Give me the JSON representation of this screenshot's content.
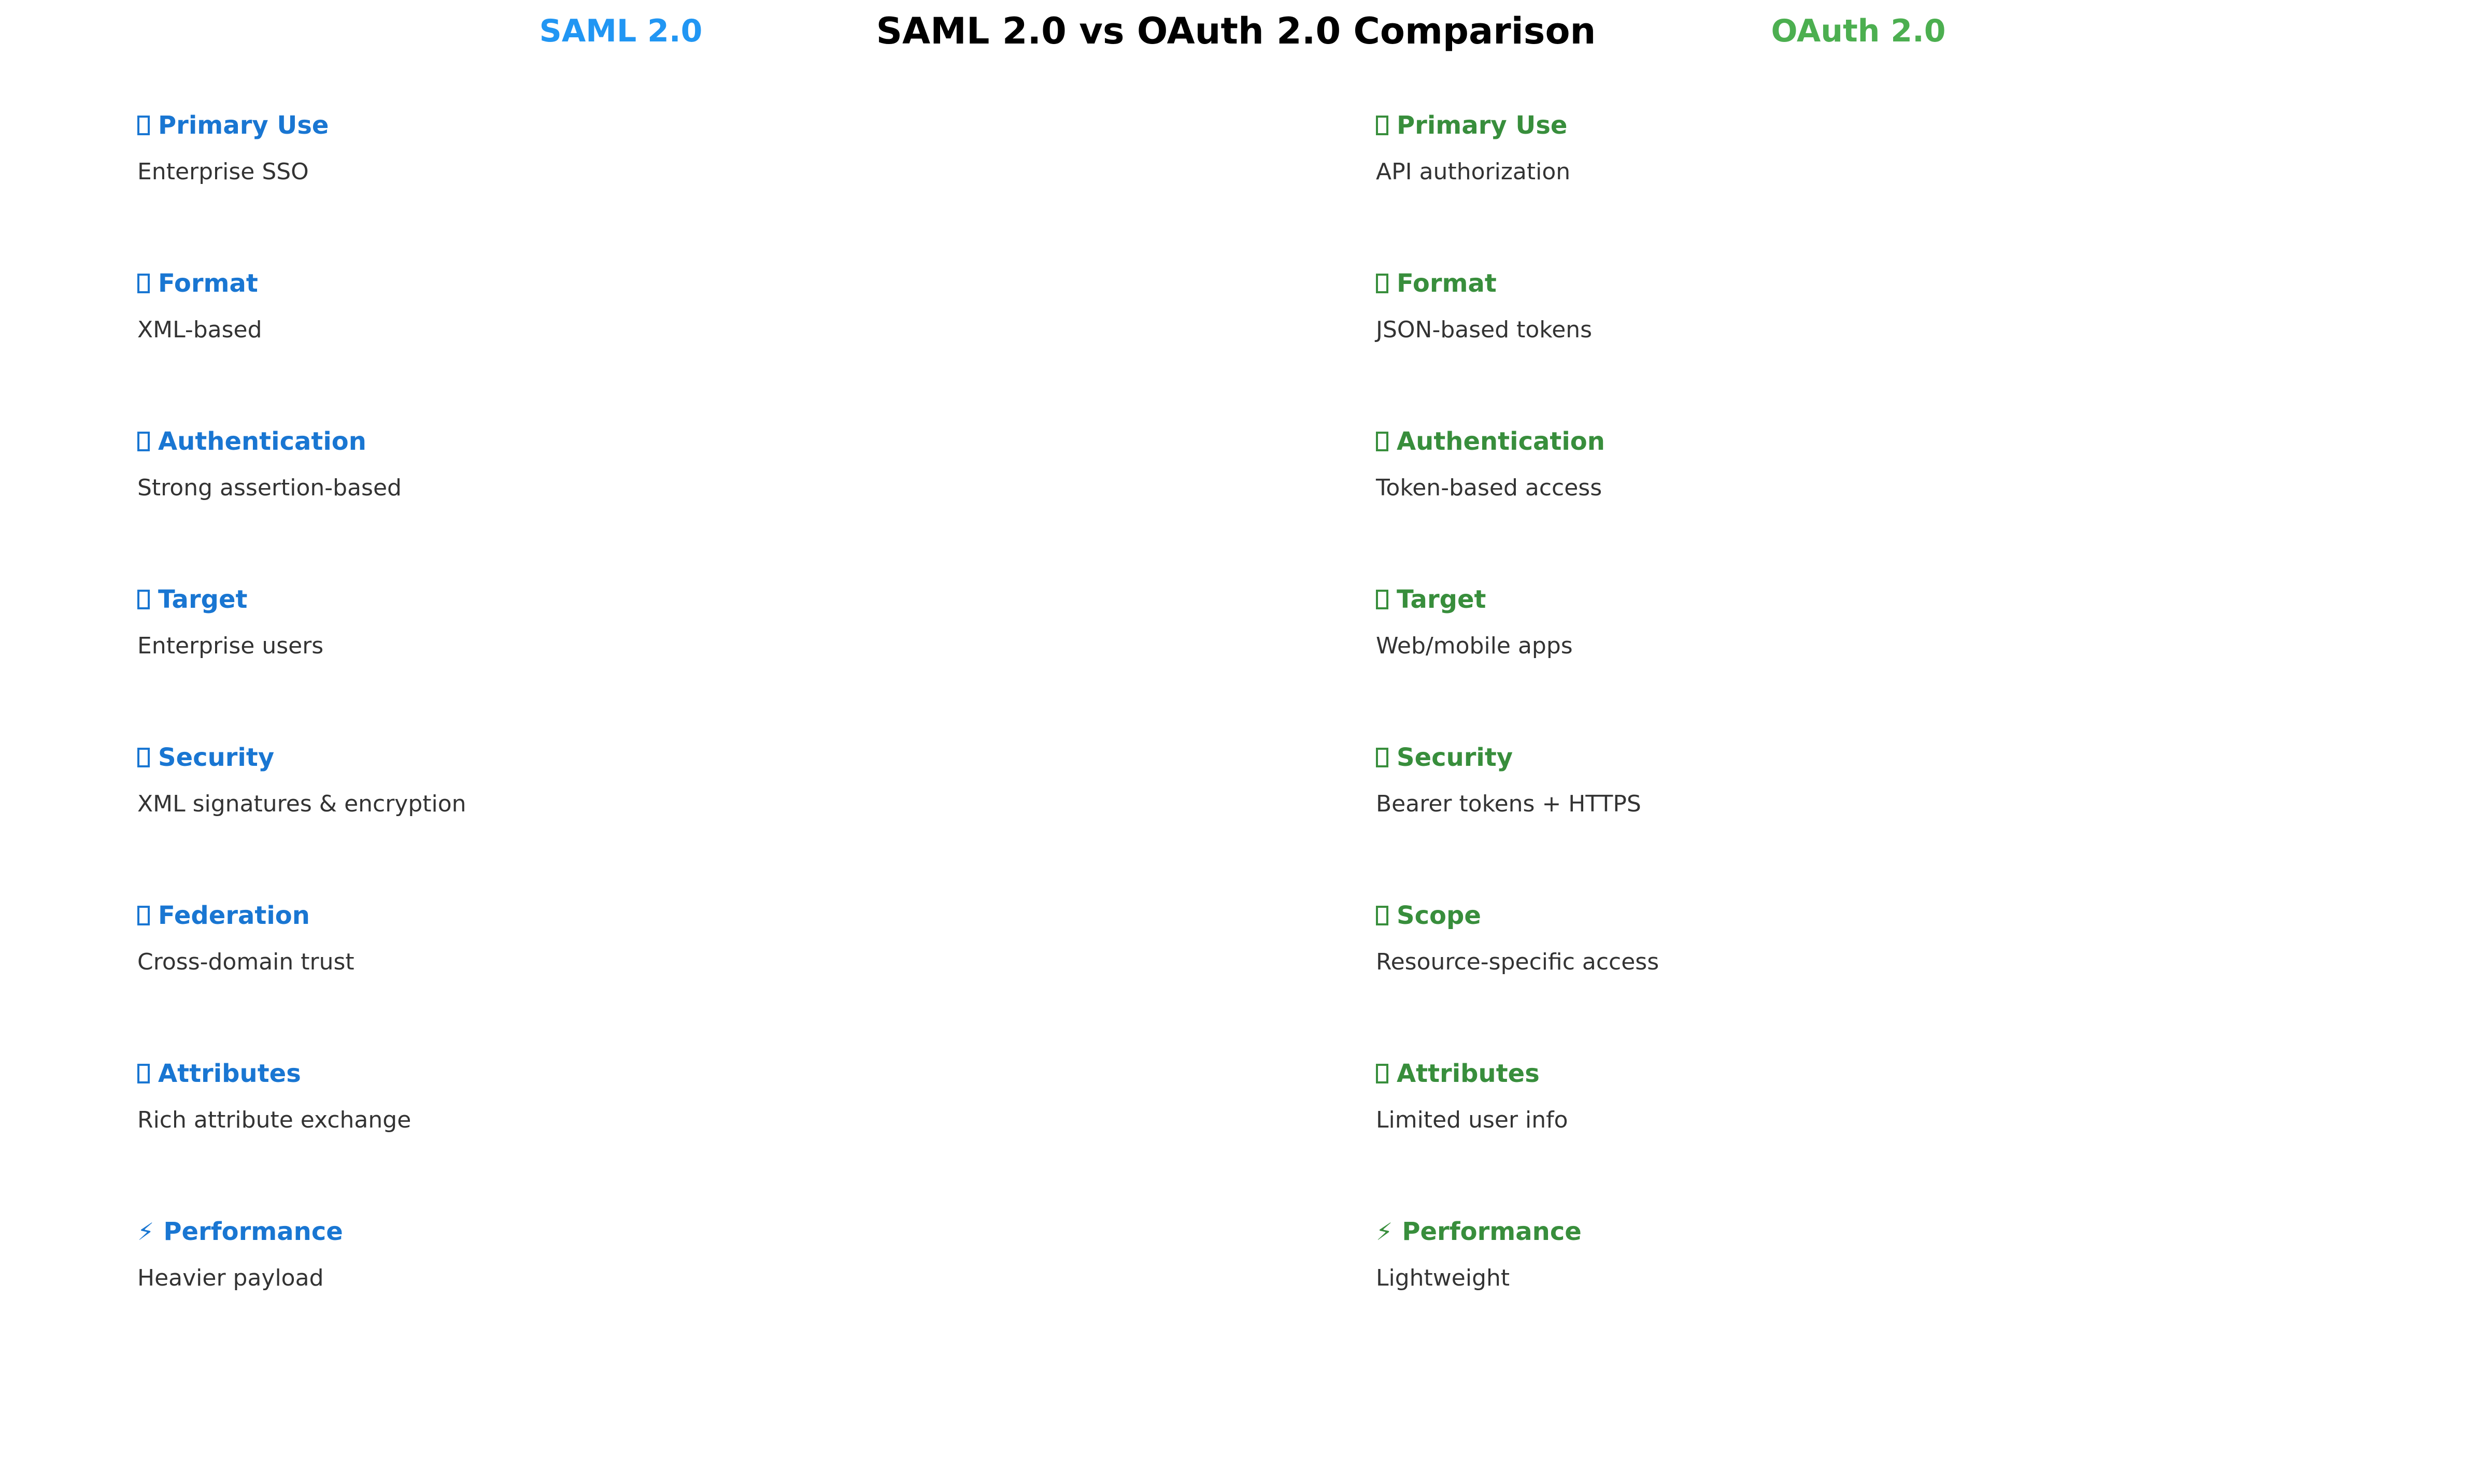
{
  "title": "SAML 2.0 vs OAuth 2.0 Comparison",
  "colors": {
    "saml_header": "#2196F3",
    "saml_text": "#1976D2",
    "oauth_header": "#4CAF50",
    "oauth_text": "#388E3C",
    "desc_text": "#333333"
  },
  "saml": {
    "header": "SAML 2.0",
    "items": [
      {
        "icon": "missing-glyph-icon",
        "label": "Primary Use",
        "desc": "Enterprise SSO"
      },
      {
        "icon": "missing-glyph-icon",
        "label": "Format",
        "desc": "XML-based"
      },
      {
        "icon": "missing-glyph-icon",
        "label": "Authentication",
        "desc": "Strong assertion-based"
      },
      {
        "icon": "missing-glyph-icon",
        "label": "Target",
        "desc": "Enterprise users"
      },
      {
        "icon": "missing-glyph-icon",
        "label": "Security",
        "desc": "XML signatures & encryption"
      },
      {
        "icon": "missing-glyph-icon",
        "label": "Federation",
        "desc": "Cross-domain trust"
      },
      {
        "icon": "missing-glyph-icon",
        "label": "Attributes",
        "desc": "Rich attribute exchange"
      },
      {
        "icon": "lightning-bolt-icon",
        "glyph": "⚡",
        "label": "Performance",
        "desc": "Heavier payload"
      }
    ]
  },
  "oauth": {
    "header": "OAuth 2.0",
    "items": [
      {
        "icon": "missing-glyph-icon",
        "label": "Primary Use",
        "desc": "API authorization"
      },
      {
        "icon": "missing-glyph-icon",
        "label": "Format",
        "desc": "JSON-based tokens"
      },
      {
        "icon": "missing-glyph-icon",
        "label": "Authentication",
        "desc": "Token-based access"
      },
      {
        "icon": "missing-glyph-icon",
        "label": "Target",
        "desc": "Web/mobile apps"
      },
      {
        "icon": "missing-glyph-icon",
        "label": "Security",
        "desc": "Bearer tokens + HTTPS"
      },
      {
        "icon": "missing-glyph-icon",
        "label": "Scope",
        "desc": "Resource-specific access"
      },
      {
        "icon": "missing-glyph-icon",
        "label": "Attributes",
        "desc": "Limited user info"
      },
      {
        "icon": "lightning-bolt-icon",
        "glyph": "⚡",
        "label": "Performance",
        "desc": "Lightweight"
      }
    ]
  }
}
